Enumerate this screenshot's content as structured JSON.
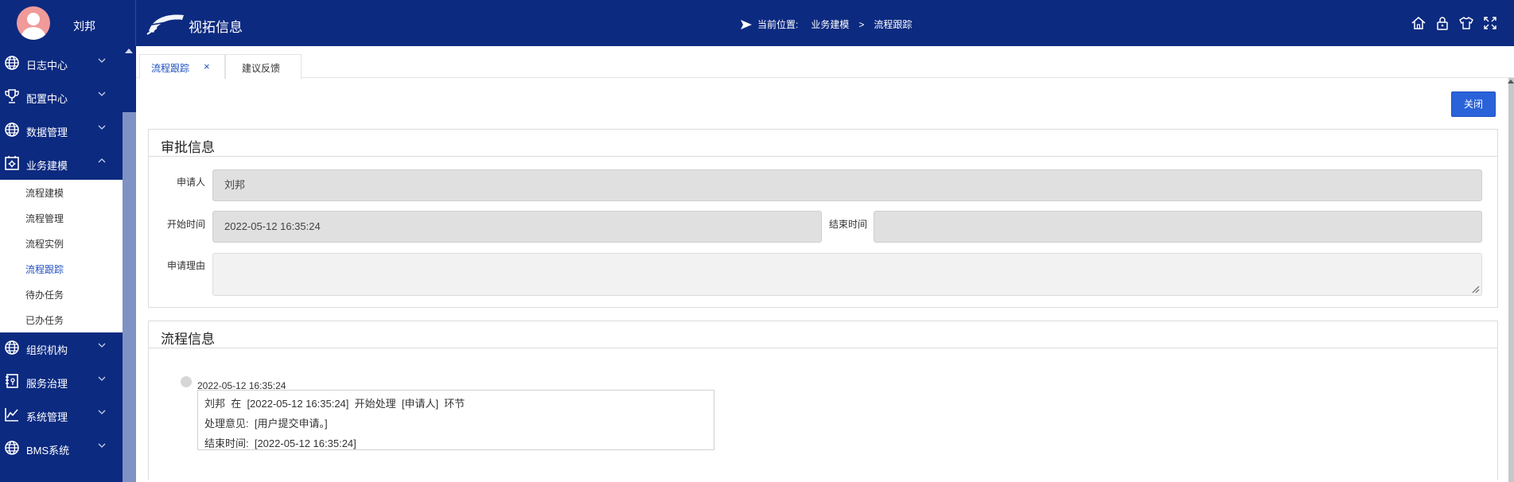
{
  "user": {
    "name": "刘邦"
  },
  "app": {
    "title": "视拓信息"
  },
  "breadcrumb": {
    "prefix": "当前位置:",
    "items": [
      "业务建模",
      "流程跟踪"
    ],
    "separator": ">"
  },
  "sidebar": {
    "items": [
      {
        "label": "日志中心",
        "icon": "globe-icon"
      },
      {
        "label": "配置中心",
        "icon": "trophy-icon"
      },
      {
        "label": "数据管理",
        "icon": "globe-icon"
      },
      {
        "label": "业务建模",
        "icon": "gear-window-icon",
        "expanded": true
      },
      {
        "label": "组织机构",
        "icon": "globe-icon"
      },
      {
        "label": "服务治理",
        "icon": "book-icon"
      },
      {
        "label": "系统管理",
        "icon": "chart-line-icon"
      },
      {
        "label": "BMS系统",
        "icon": "globe-icon"
      }
    ],
    "subitems": [
      {
        "label": "流程建模"
      },
      {
        "label": "流程管理"
      },
      {
        "label": "流程实例"
      },
      {
        "label": "流程跟踪",
        "active": true
      },
      {
        "label": "待办任务"
      },
      {
        "label": "已办任务"
      }
    ]
  },
  "tabs": [
    {
      "label": "流程跟踪",
      "close": "×",
      "active": true
    },
    {
      "label": "建议反馈"
    }
  ],
  "actions": {
    "close_label": "关闭"
  },
  "approval": {
    "title": "审批信息",
    "applicant_label": "申请人",
    "applicant_value": "刘邦",
    "start_label": "开始时间",
    "start_value": "2022-05-12 16:35:24",
    "end_label": "结束时间",
    "end_value": "",
    "reason_label": "申请理由",
    "reason_value": ""
  },
  "process": {
    "title": "流程信息",
    "events": [
      {
        "time": "2022-05-12 16:35:24",
        "line1": "刘邦  在  [2022-05-12 16:35:24]  开始处理  [申请人]  环节",
        "line2": "处理意见:  [用户提交申请。]",
        "line3": "结束时间:  [2022-05-12 16:35:24]"
      }
    ]
  },
  "colors": {
    "header": "#0c2a80",
    "accent": "#2a63d9",
    "active_text": "#1e4fbf"
  }
}
